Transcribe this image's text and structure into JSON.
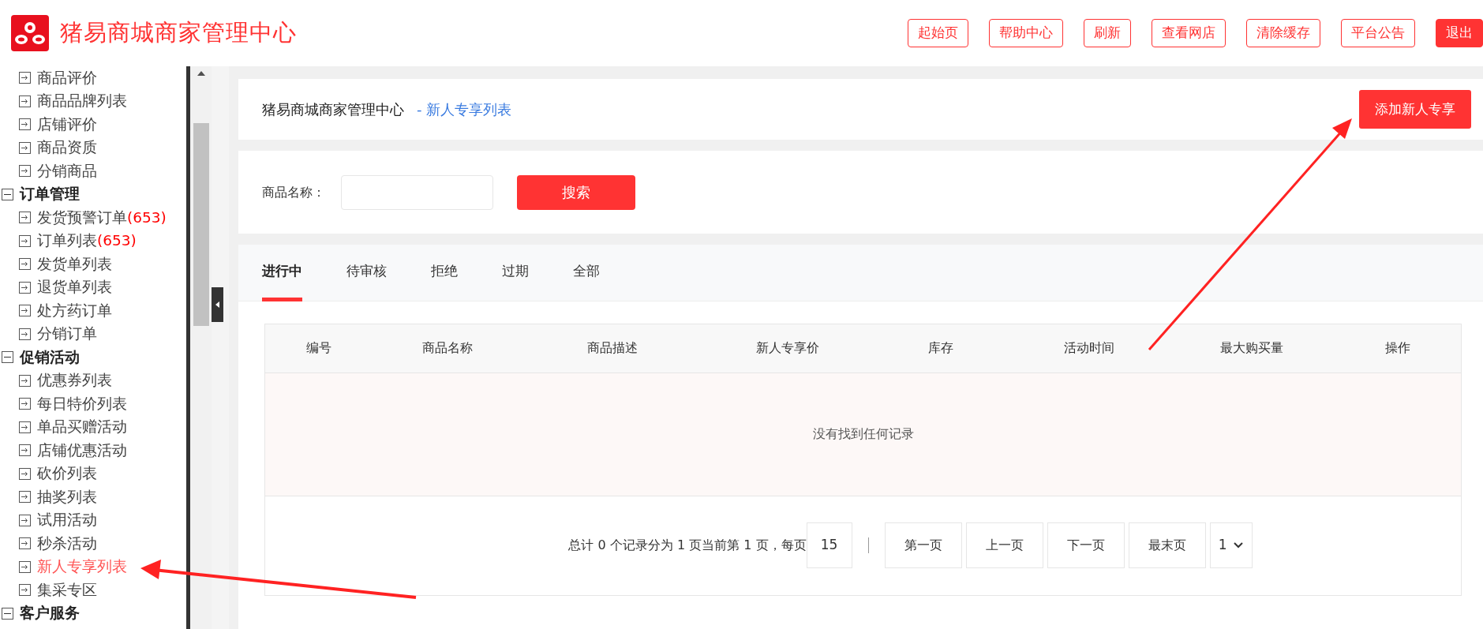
{
  "header": {
    "title": "猪易商城商家管理中心",
    "buttons": [
      {
        "label": "起始页",
        "kind": "outline"
      },
      {
        "label": "帮助中心",
        "kind": "outline"
      },
      {
        "label": "刷新",
        "kind": "outline"
      },
      {
        "label": "查看网店",
        "kind": "outline"
      },
      {
        "label": "清除缓存",
        "kind": "outline"
      },
      {
        "label": "平台公告",
        "kind": "outline"
      },
      {
        "label": "退出",
        "kind": "solid"
      }
    ]
  },
  "sidebar": {
    "items": [
      {
        "label": "商品评价",
        "selected": false
      },
      {
        "label": "商品品牌列表",
        "selected": false
      },
      {
        "label": "店铺评价",
        "selected": false
      },
      {
        "label": "商品资质",
        "selected": false
      },
      {
        "label": "分销商品",
        "selected": false
      },
      {
        "label": "订单管理",
        "expanded": true,
        "children": [
          {
            "label": "发货预警订单",
            "count": "(653)",
            "selected": false
          },
          {
            "label": "订单列表",
            "count": "(653)",
            "selected": false
          },
          {
            "label": "发货单列表",
            "selected": false
          },
          {
            "label": "退货单列表",
            "selected": false
          },
          {
            "label": "处方药订单",
            "selected": false
          },
          {
            "label": "分销订单",
            "selected": false
          }
        ]
      },
      {
        "label": "促销活动",
        "expanded": true,
        "children": [
          {
            "label": "优惠券列表",
            "selected": false
          },
          {
            "label": "每日特价列表",
            "selected": false
          },
          {
            "label": "单品买赠活动",
            "selected": false
          },
          {
            "label": "店铺优惠活动",
            "selected": false
          },
          {
            "label": "砍价列表",
            "selected": false
          },
          {
            "label": "抽奖列表",
            "selected": false
          },
          {
            "label": "试用活动",
            "selected": false
          },
          {
            "label": "秒杀活动",
            "selected": false
          },
          {
            "label": "新人专享列表",
            "selected": true
          },
          {
            "label": "集采专区",
            "selected": false
          }
        ]
      },
      {
        "label": "客户服务",
        "expanded": true
      }
    ]
  },
  "page_header": {
    "title": "猪易商城商家管理中心",
    "breadcrumb": "- 新人专享列表",
    "action": "添加新人专享"
  },
  "search": {
    "label": "商品名称：",
    "button": "搜索"
  },
  "tabs": [
    {
      "label": "进行中",
      "selected": true
    },
    {
      "label": "待审核",
      "selected": false
    },
    {
      "label": "拒绝",
      "selected": false
    },
    {
      "label": "过期",
      "selected": false
    },
    {
      "label": "全部",
      "selected": false
    }
  ],
  "table": {
    "columns": [
      "编号",
      "商品名称",
      "商品描述",
      "新人专享价",
      "库存",
      "活动时间",
      "最大购买量",
      "操作"
    ],
    "empty_message": "没有找到任何记录"
  },
  "pagination": {
    "summary": "总计 0 个记录分为 1 页当前第 1 页，每页",
    "page_size": "15",
    "buttons": [
      "第一页",
      "上一页",
      "下一页",
      "最末页"
    ],
    "page_select": "1"
  }
}
